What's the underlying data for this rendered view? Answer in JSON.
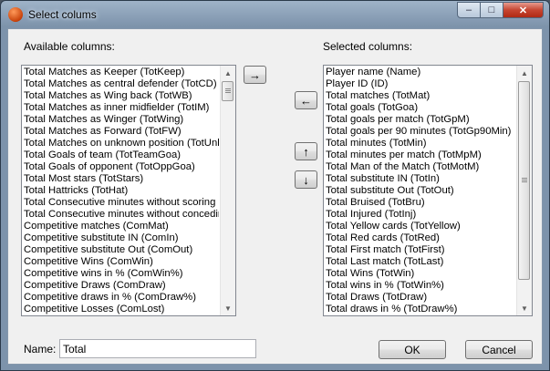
{
  "window": {
    "title": "Select colums",
    "icon": "app-ball-icon",
    "controls": {
      "minimize": "‒",
      "maximize": "□",
      "close": "✕"
    }
  },
  "available": {
    "label": "Available columns:",
    "items": [
      "Total Matches as Keeper (TotKeep)",
      "Total Matches as central defender (TotCD)",
      "Total Matches as Wing back (TotWB)",
      "Total Matches as inner midfielder (TotIM)",
      "Total Matches as Winger (TotWing)",
      "Total Matches as Forward (TotFW)",
      "Total Matches on unknown position (TotUnknown)",
      "Total Goals of team (TotTeamGoa)",
      "Total Goals of opponent (TotOppGoa)",
      "Total Most stars (TotStars)",
      "Total Hattricks (TotHat)",
      "Total Consecutive minutes without scoring a goal",
      "Total Consecutive minutes without conceding a goal",
      "Competitive matches (ComMat)",
      "Competitive substitute IN (ComIn)",
      "Competitive substitute Out (ComOut)",
      "Competitive Wins (ComWin)",
      "Competitive wins in % (ComWin%)",
      "Competitive Draws (ComDraw)",
      "Competitive draws in % (ComDraw%)",
      "Competitive Losses (ComLost)"
    ]
  },
  "selected": {
    "label": "Selected columns:",
    "items": [
      "Player name (Name)",
      "Player ID (ID)",
      "Total matches (TotMat)",
      "Total goals (TotGoa)",
      "Total goals per match (TotGpM)",
      "Total goals per 90 minutes (TotGp90Min)",
      "Total minutes (TotMin)",
      "Total minutes per match (TotMpM)",
      "Total Man of the Match (TotMotM)",
      "Total substitute IN (TotIn)",
      "Total substitute Out (TotOut)",
      "Total Bruised (TotBru)",
      "Total Injured (TotInj)",
      "Total Yellow cards (TotYellow)",
      "Total Red cards (TotRed)",
      "Total First match (TotFirst)",
      "Total Last match (TotLast)",
      "Total Wins (TotWin)",
      "Total wins in % (TotWin%)",
      "Total Draws (TotDraw)",
      "Total draws in % (TotDraw%)"
    ]
  },
  "buttons": {
    "add": "→",
    "remove": "←",
    "move_up": "↑",
    "move_down": "↓",
    "ok": "OK",
    "cancel": "Cancel"
  },
  "name_field": {
    "label": "Name:",
    "value": "Total"
  }
}
